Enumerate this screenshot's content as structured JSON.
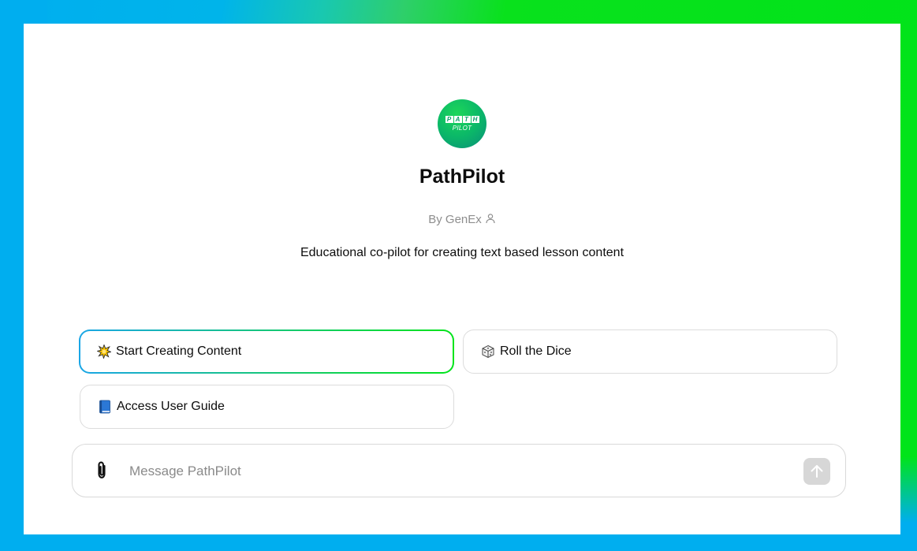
{
  "gpt": {
    "logo_letters": [
      "P",
      "A",
      "T",
      "H"
    ],
    "logo_sub": "PILOT",
    "name": "PathPilot",
    "author": "By GenEx",
    "description": "Educational co-pilot for creating text based lesson content"
  },
  "starters": [
    {
      "label": "Start Creating Content",
      "icon": "sparkle-burst-icon",
      "active": true
    },
    {
      "label": "Roll the Dice",
      "icon": "dice-icon",
      "active": false
    },
    {
      "label": "Access User Guide",
      "icon": "blue-book-icon",
      "active": false
    }
  ],
  "composer": {
    "placeholder": "Message PathPilot",
    "value": "",
    "attach_icon": "paperclip-icon",
    "send_icon": "arrow-up-icon"
  },
  "colors": {
    "frame_blue": "#00aeef",
    "frame_green": "#00e41a",
    "send_button_disabled": "#d7d7d7"
  }
}
